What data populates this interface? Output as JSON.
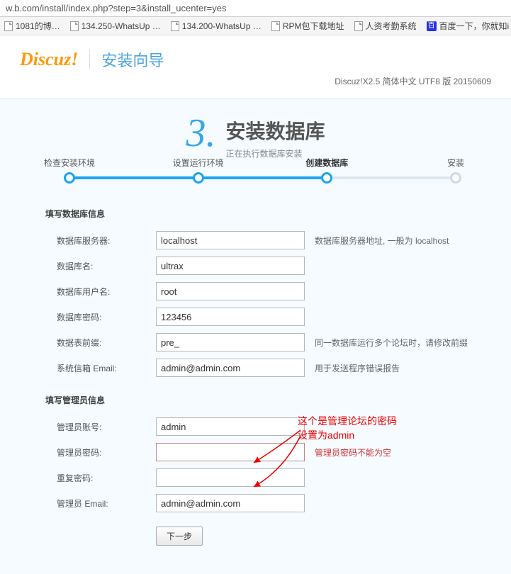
{
  "url": "w.b.com/install/index.php?step=3&install_ucenter=yes",
  "bookmarks": {
    "b1": "1081的博…",
    "b2": "134.250-WhatsUp …",
    "b3": "134.200-WhatsUp …",
    "b4": "RPM包下载地址",
    "b5": "人资考勤系统",
    "b6": "百度一下，你就知i"
  },
  "logo_text": "Discuz",
  "logo_excl": "!",
  "wizard_title": "安装向导",
  "version_text": "Discuz!X2.5 简体中文 UTF8 版 20150609",
  "step": {
    "number": "3.",
    "title": "安装数据库",
    "subtitle": "正在执行数据库安装"
  },
  "progress": {
    "s1": "检查安装环境",
    "s2": "设置运行环境",
    "s3": "创建数据库",
    "s4": "安装"
  },
  "db": {
    "section": "填写数据库信息",
    "server_lbl": "数据库服务器:",
    "server_val": "localhost",
    "server_hint": "数据库服务器地址, 一般为 localhost",
    "name_lbl": "数据库名:",
    "name_val": "ultrax",
    "user_lbl": "数据库用户名:",
    "user_val": "root",
    "pass_lbl": "数据库密码:",
    "pass_val": "123456",
    "prefix_lbl": "数据表前缀:",
    "prefix_val": "pre_",
    "prefix_hint": "同一数据库运行多个论坛时，请修改前缀",
    "email_lbl": "系统信箱 Email:",
    "email_val": "admin@admin.com",
    "email_hint": "用于发送程序错误报告"
  },
  "admin": {
    "section": "填写管理员信息",
    "acct_lbl": "管理员账号:",
    "acct_val": "admin",
    "pass_lbl": "管理员密码:",
    "pass_val": "",
    "pass_err": "管理员密码不能为空",
    "repass_lbl": "重复密码:",
    "repass_val": "",
    "email_lbl": "管理员 Email:",
    "email_val": "admin@admin.com"
  },
  "next_btn": "下一步",
  "annotation": {
    "line1": "这个是管理论坛的密码",
    "line2": "设置为admin"
  }
}
